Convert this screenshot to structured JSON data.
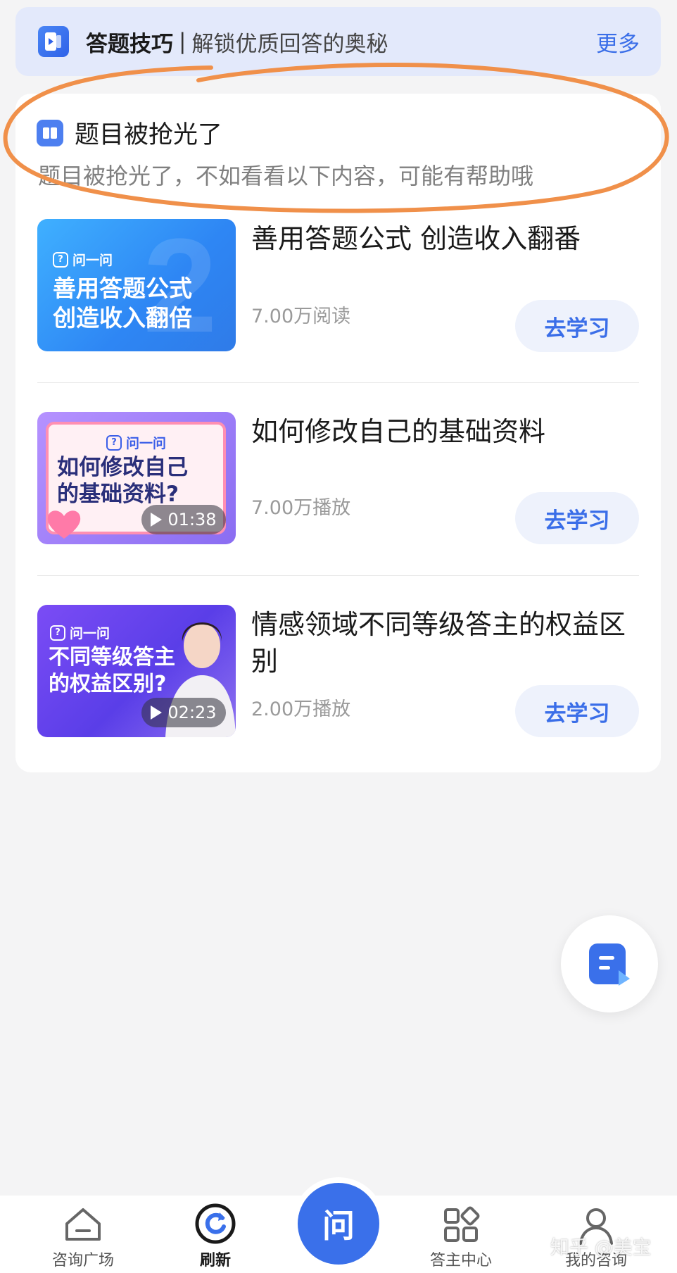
{
  "tips_banner": {
    "title": "答题技巧",
    "separator": "|",
    "subtitle": "解锁优质回答的奥秘",
    "more": "更多"
  },
  "notice": {
    "title": "题目被抢光了",
    "subtitle": "题目被抢光了，不如看看以下内容，可能有帮助哦"
  },
  "articles": [
    {
      "title": "善用答题公式 创造收入翻番",
      "stat": "7.00万阅读",
      "button": "去学习",
      "thumb_brand": "问一问",
      "thumb_text_1": "善用答题公式",
      "thumb_text_2": "创造收入翻倍"
    },
    {
      "title": "如何修改自己的基础资料",
      "stat": "7.00万播放",
      "button": "去学习",
      "thumb_brand": "问一问",
      "thumb_text_1": "如何修改自己",
      "thumb_text_2": "的基础资料?",
      "duration": "01:38"
    },
    {
      "title": "情感领域不同等级答主的权益区别",
      "stat": "2.00万播放",
      "button": "去学习",
      "thumb_brand": "问一问",
      "thumb_text_1": "不同等级答主",
      "thumb_text_2": "的权益区别?",
      "duration": "02:23"
    }
  ],
  "bottom_nav": {
    "items": [
      {
        "label": "咨询广场",
        "icon": "home-icon"
      },
      {
        "label": "刷新",
        "icon": "refresh-icon"
      },
      {
        "label": "问",
        "icon": "ask-icon"
      },
      {
        "label": "答主中心",
        "icon": "grid-icon"
      },
      {
        "label": "我的咨询",
        "icon": "user-icon"
      }
    ]
  },
  "watermark": "知乎 @美宝",
  "colors": {
    "accent": "#3a70ea",
    "annotation": "#f0904a",
    "banner_bg": "#e3e9fb",
    "button_bg": "#eef2fc"
  }
}
